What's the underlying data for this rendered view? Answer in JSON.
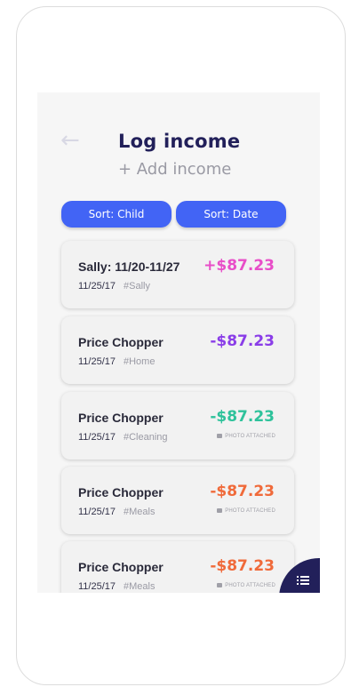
{
  "header": {
    "back_icon": "arrow-left-icon",
    "title": "Log income",
    "add_label": "+ Add income"
  },
  "sort": {
    "child_label": "Sort: Child",
    "date_label": "Sort: Date"
  },
  "entries": [
    {
      "title": "Sally: 11/20-11/27",
      "date": "11/25/17",
      "tag": "#Sally",
      "amount": "+$87.23",
      "color": "#e84ec8",
      "photo_attached": ""
    },
    {
      "title": "Price Chopper",
      "date": "11/25/17",
      "tag": "#Home",
      "amount": "-$87.23",
      "color": "#8a3de8",
      "photo_attached": ""
    },
    {
      "title": "Price Chopper",
      "date": "11/25/17",
      "tag": "#Cleaning",
      "amount": "-$87.23",
      "color": "#2ec29b",
      "photo_attached": "PHOTO ATTACHED"
    },
    {
      "title": "Price Chopper",
      "date": "11/25/17",
      "tag": "#Meals",
      "amount": "-$87.23",
      "color": "#f06a3a",
      "photo_attached": "PHOTO ATTACHED"
    },
    {
      "title": "Price Chopper",
      "date": "11/25/17",
      "tag": "#Meals",
      "amount": "-$87.23",
      "color": "#f06a3a",
      "photo_attached": "PHOTO ATTACHED"
    }
  ],
  "fab": {
    "icon": "list-menu-icon"
  },
  "colors": {
    "accent": "#4264f5",
    "title": "#22205a"
  }
}
